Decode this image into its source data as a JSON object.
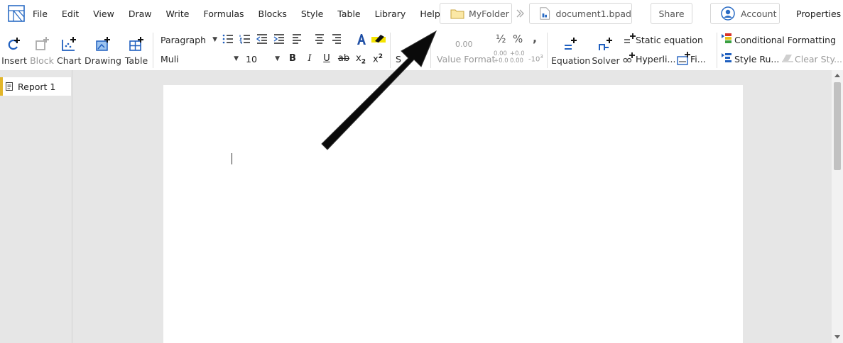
{
  "menu": [
    "File",
    "Edit",
    "View",
    "Draw",
    "Write",
    "Formulas",
    "Blocks",
    "Style",
    "Table",
    "Library",
    "Help"
  ],
  "header": {
    "folder": "MyFolder",
    "document": "document1.bpad",
    "share": "Share",
    "account": "Account",
    "properties": "Properties"
  },
  "toolbar": {
    "insert": "Insert",
    "block": "Block",
    "chart": "Chart",
    "drawing": "Drawing",
    "table": "Table",
    "paragraph_style": "Paragraph",
    "font_family": "Muli",
    "font_size": "10",
    "bold": "B",
    "italic": "I",
    "underline": "U",
    "strike": "ab",
    "subscript": "x",
    "sub_mark": "2",
    "superscript": "x",
    "sup_mark": "2",
    "style_partial": "S",
    "value_format_preview": "0.00",
    "value_format": "Value Format",
    "fraction": "½",
    "percent": "%",
    "comma": ",",
    "dec_inc": "0.00 +0.0",
    "dec_dec": "+0.0 0.00",
    "sci": "-10",
    "sci_exp": "3",
    "equation": "Equation",
    "solver": "Solver",
    "static_equation": "Static equation",
    "hyperlink": "Hyperli...",
    "figure": "Fi...",
    "conditional_formatting": "Conditional Formatting",
    "style_rules": "Style Ru...",
    "clear_styles": "Clear Sty..."
  },
  "sidebar": {
    "tabs": [
      "Report 1"
    ]
  },
  "colors": {
    "accent_tab": "#e2b62a",
    "icon_blue": "#1f5fbf",
    "arrow": "#0a0a0a"
  }
}
